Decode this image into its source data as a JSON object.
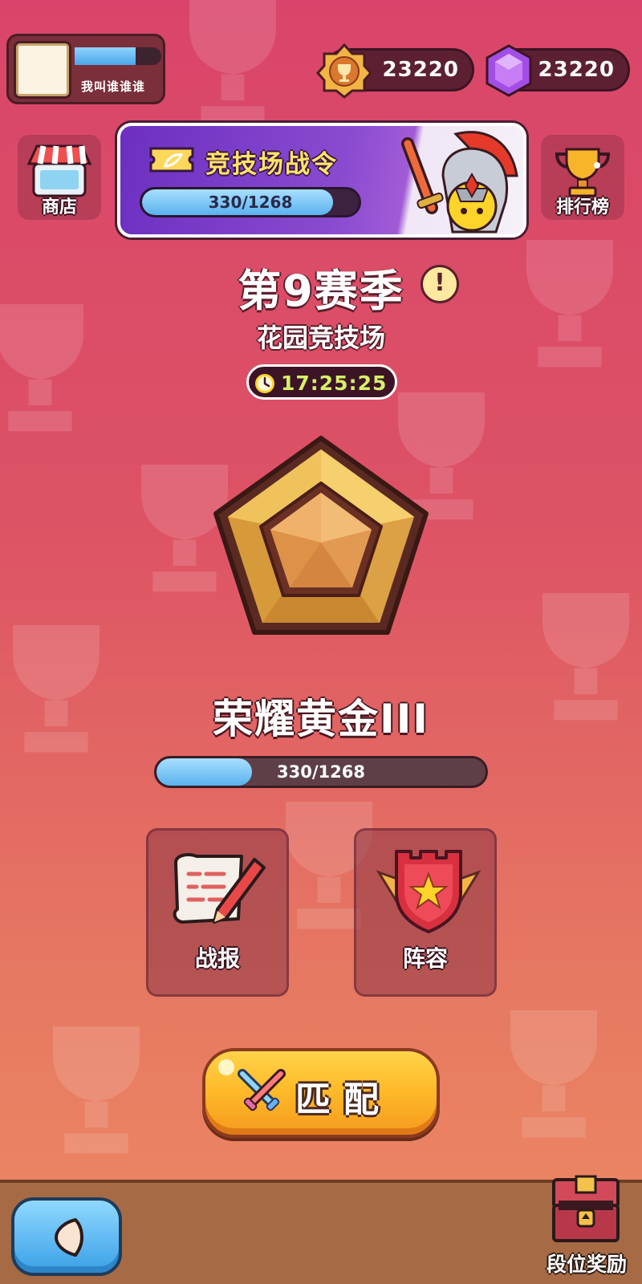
{
  "player": {
    "name": "我叫谁谁谁",
    "xp_fraction": 0.7
  },
  "currency": {
    "trophies": "23220",
    "gems": "23220"
  },
  "side_buttons": {
    "shop": "商店",
    "leaderboard": "排行榜"
  },
  "battle_pass": {
    "title": "竞技场战令",
    "progress": "330/1268",
    "progress_fraction": 0.88
  },
  "season": {
    "title": "第9赛季",
    "info_glyph": "!",
    "arena": "花园竞技场",
    "timer": "17:25:25"
  },
  "rank": {
    "name": "荣耀黄金III",
    "progress": "330/1268",
    "progress_fraction": 0.29
  },
  "actions": {
    "report": "战报",
    "lineup": "阵容"
  },
  "match_button": "匹配",
  "bottom": {
    "rank_reward": "段位奖励"
  },
  "colors": {
    "background_top": "#d9456a",
    "background_bottom": "#ec8a63",
    "gold": "#f2b544",
    "gem_purple": "#a24ee6",
    "progress_blue": "#5ab2ee",
    "match_orange": "#ffbb2a",
    "timer_text": "#d6f06a"
  },
  "icons": {
    "trophy": "trophy-badge-icon",
    "gem": "purple-gem-icon",
    "shop": "shop-stall-icon",
    "leaderboard": "gold-cup-icon",
    "ticket": "ticket-icon",
    "knight": "knight-helmet-icon",
    "info": "info-icon",
    "timer": "stopwatch-icon",
    "report": "scroll-pen-icon",
    "lineup": "shield-star-icon",
    "match": "crossed-swords-icon",
    "back": "back-arrow-icon",
    "reward": "treasure-chest-icon"
  }
}
